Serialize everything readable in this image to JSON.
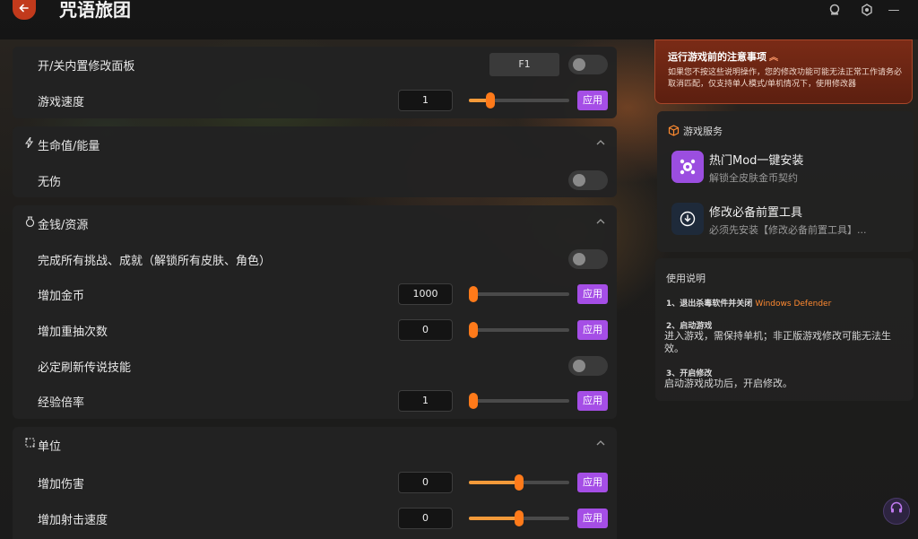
{
  "app": {
    "title": "咒语旅团",
    "back_icon": "arrow-left-icon"
  },
  "titlebar": {
    "icons": [
      "user-icon",
      "gear-icon",
      "minimize-icon"
    ],
    "minimize": "—"
  },
  "top": {
    "panel_toggle_label": "开/关内置修改面板",
    "hotkey": "F1",
    "game_speed_label": "游戏速度",
    "game_speed_value": "1",
    "apply": "应用"
  },
  "sections": {
    "hp": {
      "title": "生命值/能量",
      "icon": "lightning-icon",
      "rows": {
        "invincible": "无伤"
      }
    },
    "money": {
      "title": "金钱/资源",
      "icon": "money-bag-icon",
      "rows": {
        "complete_all": "完成所有挑战、成就（解锁所有皮肤、角色）",
        "add_gold": "增加金币",
        "add_gold_value": "1000",
        "add_reroll": "增加重抽次数",
        "add_reroll_value": "0",
        "legendary": "必定刷新传说技能",
        "exp_rate": "经验倍率",
        "exp_rate_value": "1"
      }
    },
    "unit": {
      "title": "单位",
      "icon": "unit-icon",
      "rows": {
        "add_damage": "增加伤害",
        "add_damage_value": "0",
        "add_attack_speed": "增加射击速度",
        "add_attack_speed_value": "0"
      }
    }
  },
  "sliders": {
    "game_speed": 0.19,
    "add_gold": 0.0,
    "add_reroll": 0.0,
    "exp_rate": 0.0,
    "add_damage": 0.5,
    "add_attack_speed": 0.5
  },
  "notice": {
    "title": "运行游戏前的注意事项",
    "body": "如果您不按这些说明操作，您的修改功能可能无法正常工作请务必取消匹配，仅支持单人模式/单机情况下，使用修改器"
  },
  "services": {
    "title": "游戏服务",
    "items": [
      {
        "title": "热门Mod一键安装",
        "subtitle": "解锁全皮肤金币契约",
        "icon": "mod-icon",
        "color": "#9b4ee0"
      },
      {
        "title": "修改必备前置工具",
        "subtitle": "必须先安装【修改必备前置工具】...",
        "icon": "download-icon",
        "color": "#1e2a3a"
      }
    ]
  },
  "usage": {
    "title": "使用说明",
    "step1_title": "1、退出杀毒软件并关闭",
    "step1_highlight": "Windows Defender",
    "step2_title": "2、启动游戏",
    "step2_text": "进入游戏，需保持单机；非正版游戏修改可能无法生效。",
    "step3_title": "3、开启修改",
    "step3_text": "启动游戏成功后，开启修改。"
  },
  "colors": {
    "accent": "#a54ee6",
    "slider": "#ff7a1a",
    "notice": "#7a2b16",
    "highlight": "#ff8a30"
  }
}
